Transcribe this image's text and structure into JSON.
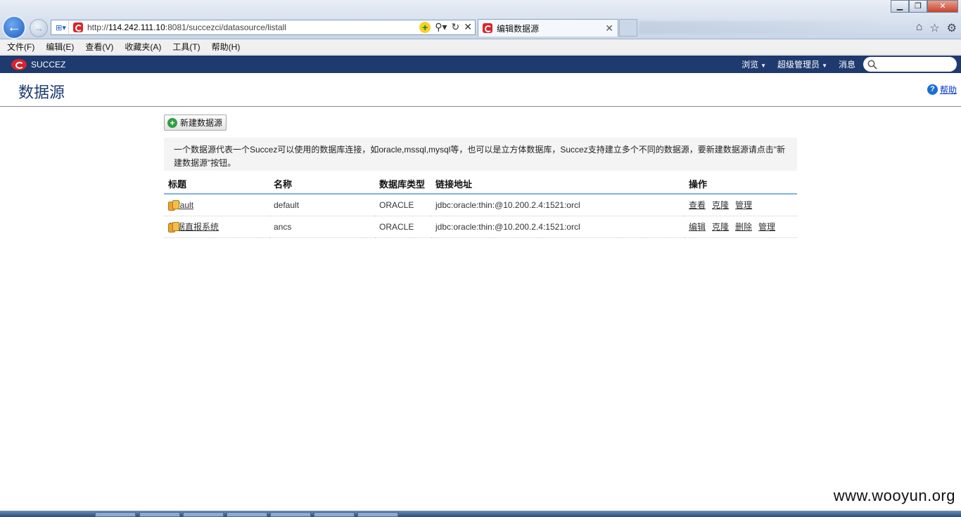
{
  "browser": {
    "url_prefix": "http://",
    "url_host": "114.242.111.10",
    "url_rest": ":8081/succezci/datasource/listall",
    "tab_title": "编辑数据源",
    "menu": [
      "文件(F)",
      "编辑(E)",
      "查看(V)",
      "收藏夹(A)",
      "工具(T)",
      "帮助(H)"
    ]
  },
  "app": {
    "brand": "SUCCEZ",
    "nav": {
      "browse": "浏览",
      "admin": "超级管理员",
      "messages": "消息"
    },
    "search_placeholder": ""
  },
  "page": {
    "title": "数据源",
    "help_label": "帮助",
    "new_button_label": "新建数据源",
    "description": "一个数据源代表一个Succez可以使用的数据库连接，如oracle,mssql,mysql等，也可以是立方体数据库，Succez支持建立多个不同的数据源，要新建数据源请点击\"新建数据源\"按钮。"
  },
  "table": {
    "headers": [
      "标题",
      "名称",
      "数据库类型",
      "链接地址",
      "操作"
    ],
    "rows": [
      {
        "title": "default",
        "name": "default",
        "db_type": "ORACLE",
        "url": "jdbc:oracle:thin:@10.200.2.4:1521:orcl",
        "actions": [
          "查看",
          "克隆",
          "管理"
        ]
      },
      {
        "title": "数据直报系统",
        "name": "ancs",
        "db_type": "ORACLE",
        "url": "jdbc:oracle:thin:@10.200.2.4:1521:orcl",
        "actions": [
          "编辑",
          "克隆",
          "删除",
          "管理"
        ]
      }
    ]
  },
  "watermark": "www.wooyun.org",
  "colors": {
    "header_bg": "#1e3a6e",
    "title_color": "#1e3a6e",
    "table_header_rule": "#7fb4e8",
    "brand_red": "#d9242a"
  }
}
